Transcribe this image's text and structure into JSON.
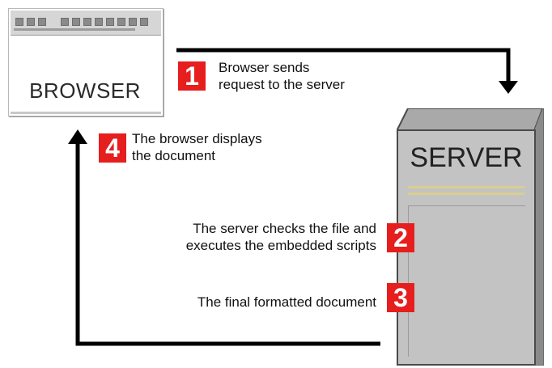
{
  "browser": {
    "label": "BROWSER"
  },
  "server": {
    "label": "SERVER"
  },
  "steps": [
    {
      "number": "1",
      "text": "Browser sends\nrequest to the server"
    },
    {
      "number": "2",
      "text": "The server checks the file and\nexecutes the embedded scripts"
    },
    {
      "number": "3",
      "text": "The final formatted document"
    },
    {
      "number": "4",
      "text": "The browser displays\nthe document"
    }
  ],
  "colors": {
    "badge": "#e61e1e",
    "arrow": "#000000",
    "server_body": "#c3c3c3",
    "stripe": "#d9cf8f"
  }
}
